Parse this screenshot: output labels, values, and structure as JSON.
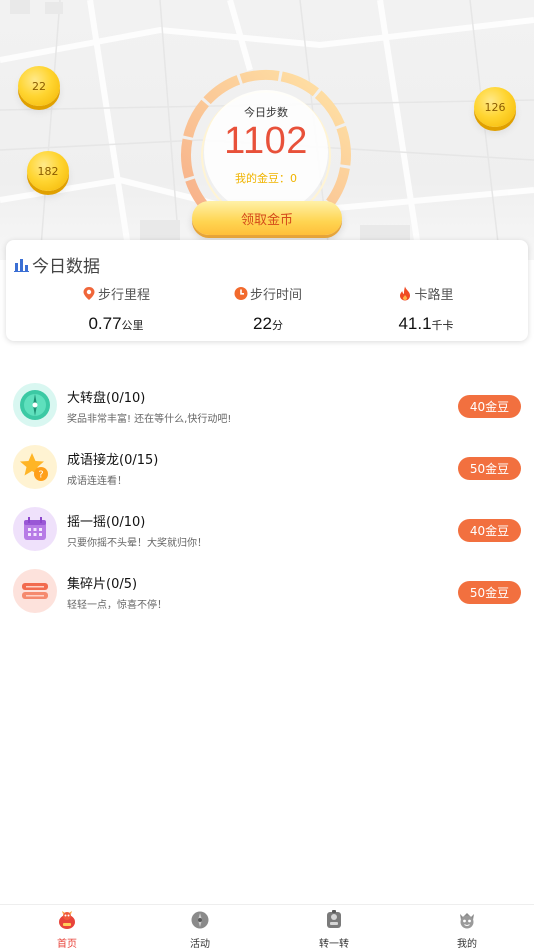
{
  "hero": {
    "coins": [
      "22",
      "126",
      "182"
    ],
    "steps_title": "今日步数",
    "steps_value": "1102",
    "my_coins": "我的金豆：0",
    "claim_button": "领取金币"
  },
  "today_data": {
    "title": "今日数据",
    "stats": [
      {
        "label": "步行里程",
        "value": "0.77",
        "unit": "公里",
        "icon": "location-pin-icon"
      },
      {
        "label": "步行时间",
        "value": "22",
        "unit": "分",
        "icon": "clock-icon"
      },
      {
        "label": "卡路里",
        "value": "41.1",
        "unit": "千卡",
        "icon": "flame-icon"
      }
    ]
  },
  "tasks": [
    {
      "title": "大转盘(0/10)",
      "desc": "奖品非常丰富! 还在等什么,快行动吧!",
      "button": "40金豆",
      "icon": "wheel-icon"
    },
    {
      "title": "成语接龙(0/15)",
      "desc": "成语连连看！",
      "button": "50金豆",
      "icon": "star-question-icon"
    },
    {
      "title": "摇一摇(0/10)",
      "desc": "只要你摇不头晕！大奖就归你！",
      "button": "40金豆",
      "icon": "calendar-icon"
    },
    {
      "title": "集碎片(0/5)",
      "desc": "轻轻一点，惊喜不停！",
      "button": "50金豆",
      "icon": "ticket-icon"
    }
  ],
  "tabbar": {
    "items": [
      {
        "label": "首页",
        "icon": "home-bird-icon"
      },
      {
        "label": "活动",
        "icon": "activity-icon"
      },
      {
        "label": "转一转",
        "icon": "spin-icon"
      },
      {
        "label": "我的",
        "icon": "profile-icon"
      }
    ]
  },
  "colors": {
    "accent": "#e8513a",
    "button_orange": "#f2703f",
    "gold": "#ffd531"
  }
}
